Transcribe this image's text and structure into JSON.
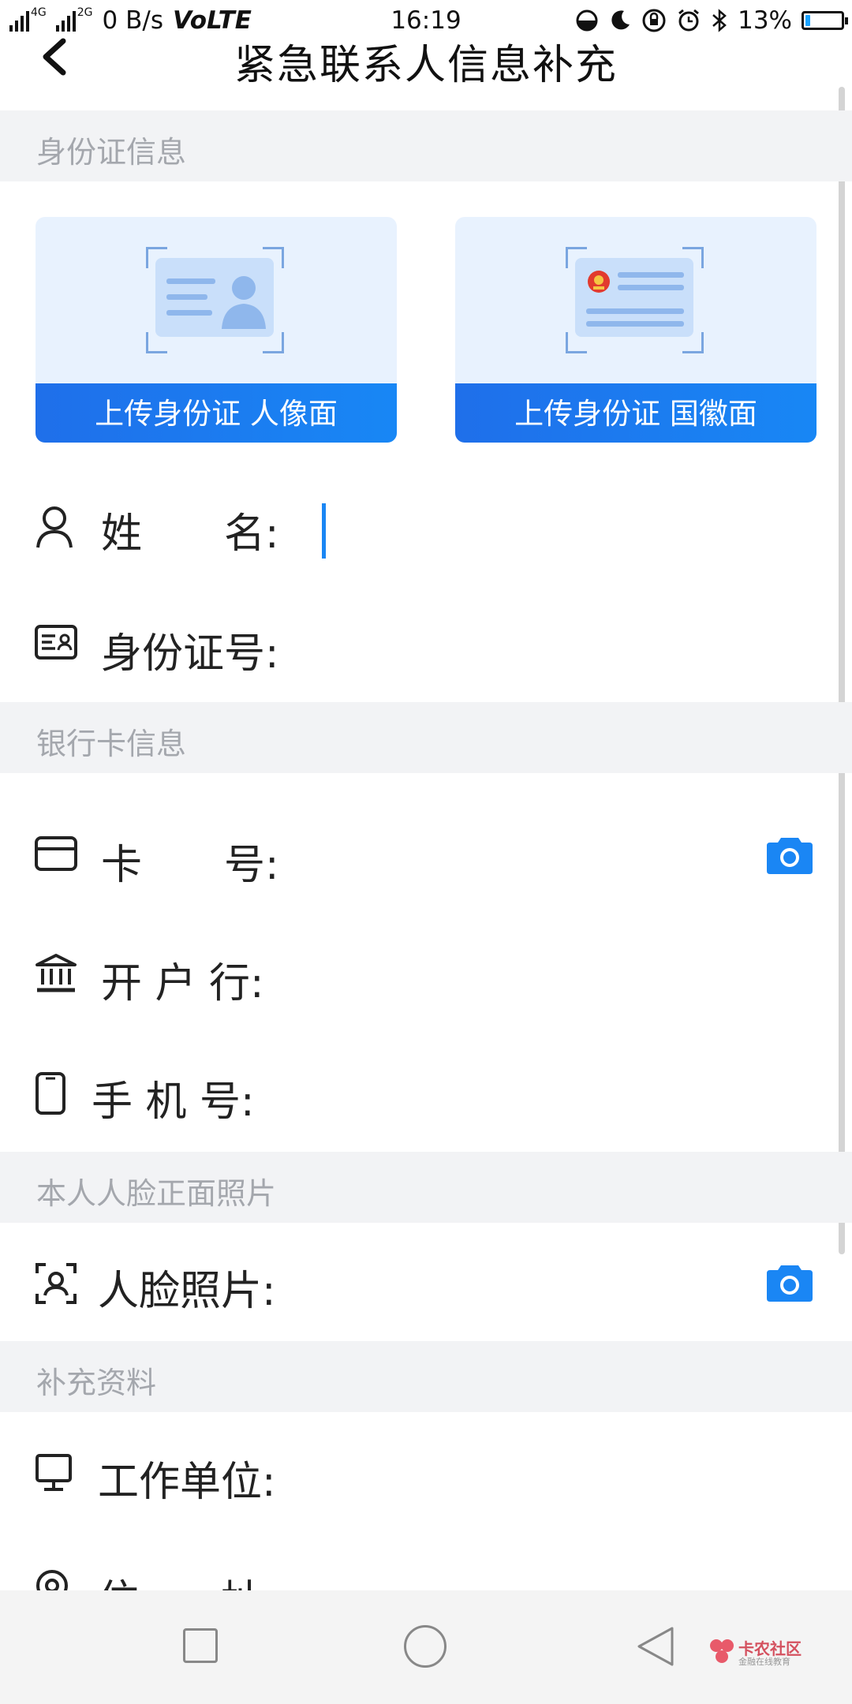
{
  "status_bar": {
    "net_1": "4G",
    "net_2": "2G",
    "speed": "0 B/s",
    "volte": "VoLTE",
    "time": "16:19",
    "battery": "13%",
    "battery_level": 0.13
  },
  "header": {
    "back_icon": "chevron-left-icon",
    "title": "紧急联系人信息补充"
  },
  "sections": {
    "id": "身份证信息",
    "bank": "银行卡信息",
    "face": "本人人脸正面照片",
    "extra": "补充资料"
  },
  "upload": {
    "front_label": "上传身份证 人像面",
    "back_label": "上传身份证 国徽面"
  },
  "fields": {
    "name": "姓　　名:",
    "id_number": "身份证号:",
    "card_number": "卡　　号:",
    "bank": "开 户 行:",
    "phone": "手 机 号:",
    "face_photo": "人脸照片:",
    "employer": "工作单位:",
    "address": "住　　址:"
  },
  "watermark": {
    "brand": "卡农社区",
    "slogan": "金融在线教育"
  },
  "colors": {
    "accent": "#1a86f4",
    "section_bg": "#f2f3f5",
    "section_text": "#a4a7ad"
  }
}
